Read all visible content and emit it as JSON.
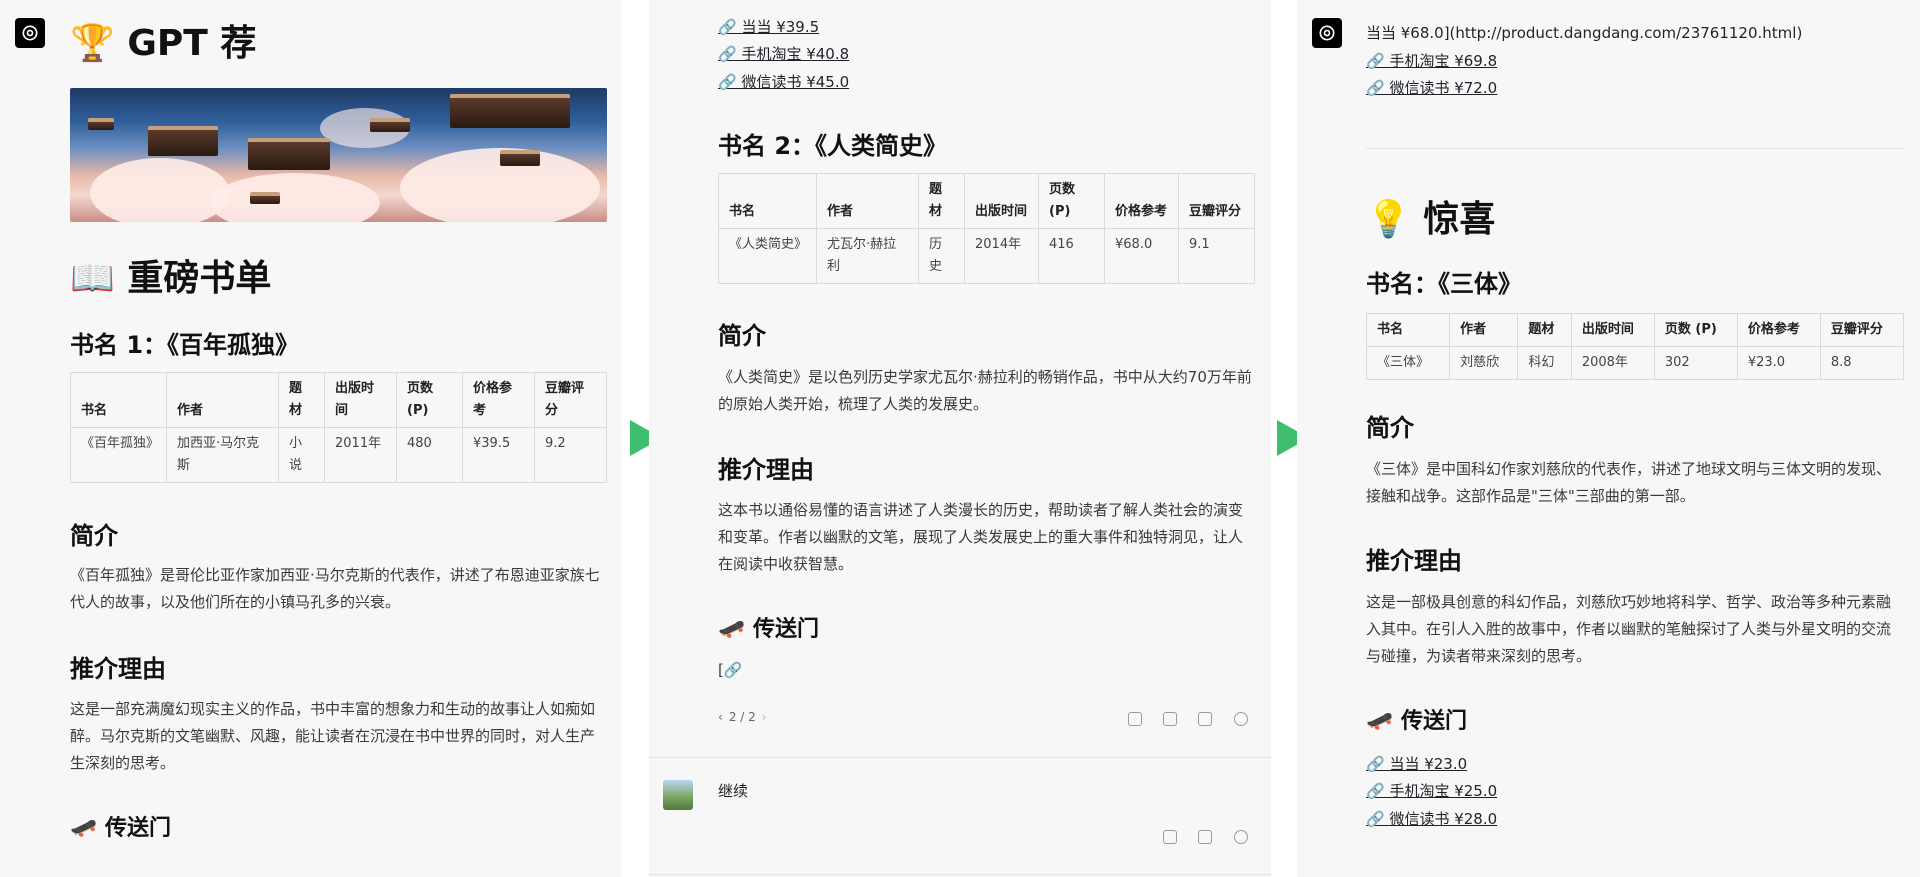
{
  "panel1": {
    "title": "🏆 GPT 荐",
    "list_heading": "📖 重磅书单",
    "book_title": "书名 1：《百年孤独》",
    "table": {
      "headers": [
        "书名",
        "作者",
        "题材",
        "出版时间",
        "页数 (P)",
        "价格参考",
        "豆瓣评分"
      ],
      "row": [
        "《百年孤独》",
        "加西亚·马尔克斯",
        "小说",
        "2011年",
        "480",
        "¥39.5",
        "9.2"
      ]
    },
    "intro_heading": "简介",
    "intro_text": "《百年孤独》是哥伦比亚作家加西亚·马尔克斯的代表作，讲述了布恩迪亚家族七代人的故事，以及他们所在的小镇马孔多的兴衰。",
    "reason_heading": "推介理由",
    "reason_text": "这是一部充满魔幻现实主义的作品，书中丰富的想象力和生动的故事让人如痴如醉。马尔克斯的文笔幽默、风趣，能让读者在沉浸在书中世界的同时，对人生产生深刻的思考。",
    "portal_heading": "🛹 传送门"
  },
  "panel2": {
    "links": [
      "🔗 当当 ¥39.5",
      "🔗 手机淘宝 ¥40.8",
      "🔗 微信读书 ¥45.0"
    ],
    "book_title": "书名 2：《人类简史》",
    "table": {
      "headers": [
        "书名",
        "作者",
        "题材",
        "出版时间",
        "页数 (P)",
        "价格参考",
        "豆瓣评分"
      ],
      "row": [
        "《人类简史》",
        "尤瓦尔·赫拉利",
        "历史",
        "2014年",
        "416",
        "¥68.0",
        "9.1"
      ]
    },
    "intro_heading": "简介",
    "intro_text": "《人类简史》是以色列历史学家尤瓦尔·赫拉利的畅销作品，书中从大约70万年前的原始人类开始，梳理了人类的发展史。",
    "reason_heading": "推介理由",
    "reason_text": "这本书以通俗易懂的语言讲述了人类漫长的历史，帮助读者了解人类社会的演变和变革。作者以幽默的文笔，展现了人类发展史上的重大事件和独特洞见，让人在阅读中收获智慧。",
    "portal_heading": "🛹 传送门",
    "portal_partial": "[🔗",
    "pager": "2 / 2",
    "user_message": "继续"
  },
  "panel3": {
    "top_line": "当当 ¥68.0](http://product.dangdang.com/23761120.html)",
    "top_links": [
      "🔗 手机淘宝 ¥69.8",
      "🔗 微信读书 ¥72.0"
    ],
    "surprise_heading": "💡 惊喜",
    "book_title": "书名：《三体》",
    "table": {
      "headers": [
        "书名",
        "作者",
        "题材",
        "出版时间",
        "页数 (P)",
        "价格参考",
        "豆瓣评分"
      ],
      "row": [
        "《三体》",
        "刘慈欣",
        "科幻",
        "2008年",
        "302",
        "¥23.0",
        "8.8"
      ]
    },
    "intro_heading": "简介",
    "intro_text": "《三体》是中国科幻作家刘慈欣的代表作，讲述了地球文明与三体文明的发现、接触和战争。这部作品是\"三体\"三部曲的第一部。",
    "reason_heading": "推介理由",
    "reason_text": "这是一部极具创意的科幻作品，刘慈欣巧妙地将科学、哲学、政治等多种元素融入其中。在引人入胜的故事中，作者以幽默的笔触探讨了人类与外星文明的交流与碰撞，为读者带来深刻的思考。",
    "portal_heading": "🛹 传送门",
    "links": [
      "🔗 当当 ¥23.0",
      "🔗 手机淘宝 ¥25.0",
      "🔗 微信读书 ¥28.0"
    ]
  },
  "colors": {
    "arrow": "#3dbf6d",
    "panel_bg": "#f7f7f8"
  }
}
